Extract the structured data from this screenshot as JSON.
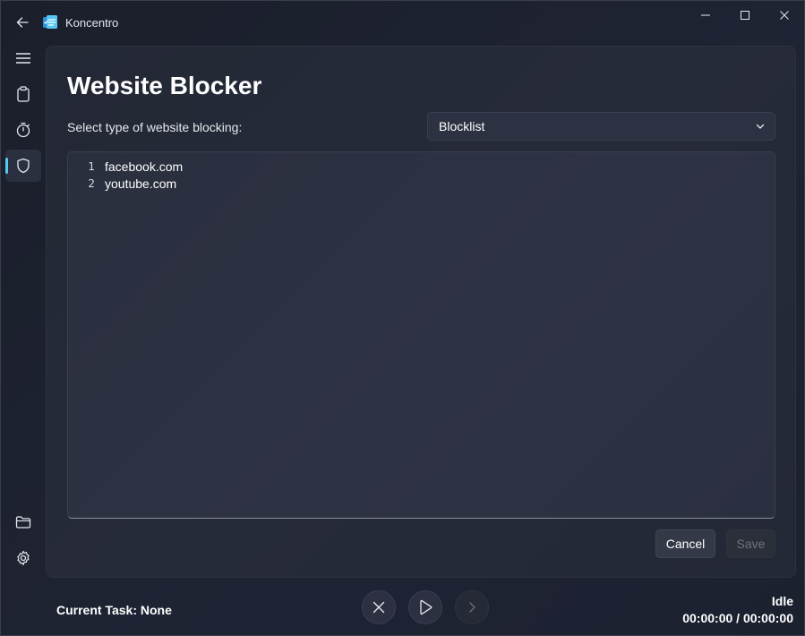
{
  "window": {
    "title": "Koncentro",
    "controls": {
      "minimize": "minimize-icon",
      "maximize": "maximize-icon",
      "close": "close-icon"
    }
  },
  "nav": {
    "items": [
      {
        "id": "menu",
        "icon": "hamburger-icon"
      },
      {
        "id": "tasks",
        "icon": "clipboard-icon"
      },
      {
        "id": "timer",
        "icon": "stopwatch-icon"
      },
      {
        "id": "website-blocker",
        "icon": "shield-icon",
        "active": true
      },
      {
        "id": "workspaces",
        "icon": "folder-icon"
      },
      {
        "id": "settings",
        "icon": "gear-icon"
      }
    ]
  },
  "page": {
    "title": "Website Blocker",
    "select_label": "Select type of website blocking:",
    "blocking_type": "Blocklist"
  },
  "editor": {
    "lines": [
      {
        "num": "1",
        "text": "facebook.com"
      },
      {
        "num": "2",
        "text": "youtube.com"
      }
    ]
  },
  "buttons": {
    "cancel": "Cancel",
    "save": "Save"
  },
  "footer": {
    "current_task": "Current Task: None",
    "status": "Idle",
    "timer": "00:00:00 / 00:00:00"
  },
  "colors": {
    "accent": "#56c7f4",
    "background": "#1c2130"
  }
}
